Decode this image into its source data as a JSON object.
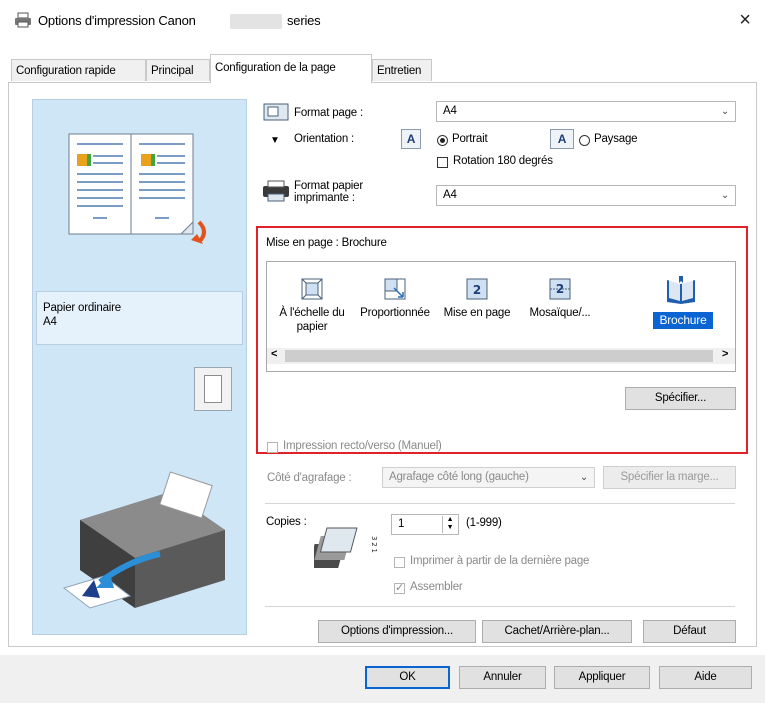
{
  "window": {
    "title": "Options d'impression Canon",
    "title_suffix": "series",
    "close_glyph": "×"
  },
  "tabs": [
    {
      "label": "Configuration rapide",
      "active": false
    },
    {
      "label": "Principal",
      "active": false
    },
    {
      "label": "Configuration de la page",
      "active": true
    },
    {
      "label": "Entretien",
      "active": false
    }
  ],
  "preview": {
    "paper_type": "Papier ordinaire",
    "paper_size": "A4"
  },
  "page_setup": {
    "format_page_label": "Format page :",
    "format_page_value": "A4",
    "orientation_label": "Orientation :",
    "portrait_label": "Portrait",
    "paysage_label": "Paysage",
    "orientation_selected": "Portrait",
    "rotation_label": "Rotation 180 degrés",
    "rotation_checked": false,
    "format_papier_label_1": "Format papier",
    "format_papier_label_2": "imprimante :",
    "format_papier_value": "A4"
  },
  "layout": {
    "title": "Mise en page :  Brochure",
    "options": [
      {
        "label_1": "À l'échelle du",
        "label_2": "papier",
        "icon": "fit-to-page-icon"
      },
      {
        "label_1": "Proportionnée",
        "label_2": "",
        "icon": "scaled-icon"
      },
      {
        "label_1": "Mise en page",
        "label_2": "",
        "icon": "page-layout-icon"
      },
      {
        "label_1": "Mosaïque/...",
        "label_2": "",
        "icon": "tiling-icon"
      },
      {
        "label_1": "Brochure",
        "label_2": "",
        "icon": "booklet-icon"
      }
    ],
    "selected": "Brochure",
    "scroll_left": "<",
    "scroll_right": ">",
    "specify_button": "Spécifier..."
  },
  "duplex": {
    "checkbox_label": "Impression recto/verso (Manuel)",
    "checked": false,
    "stapling_label": "Côté d'agrafage :",
    "stapling_value": "Agrafage côté long (gauche)",
    "margin_button": "Spécifier la marge..."
  },
  "copies": {
    "label": "Copies :",
    "value": "1",
    "range": "(1-999)",
    "print_from_last": "Imprimer à partir de la dernière page",
    "print_from_last_checked": false,
    "collate": "Assembler",
    "collate_checked": true
  },
  "panel_buttons": {
    "print_options": "Options d'impression...",
    "stamp_background": "Cachet/Arrière-plan...",
    "default": "Défaut"
  },
  "dialog_buttons": {
    "ok": "OK",
    "cancel": "Annuler",
    "apply": "Appliquer",
    "help": "Aide"
  },
  "colors": {
    "highlight": "#e0202a",
    "selection": "#0a64d2",
    "preview_bg": "#cfe6f7"
  }
}
